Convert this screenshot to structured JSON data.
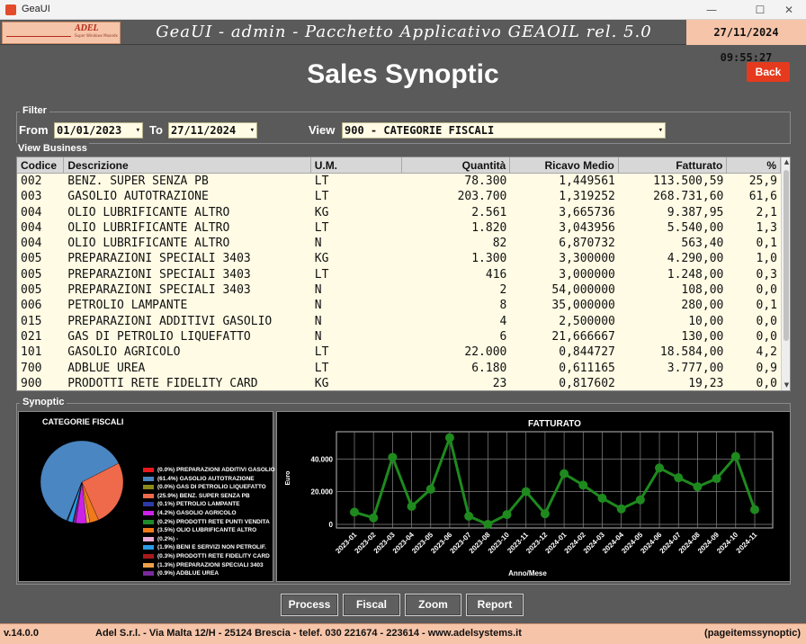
{
  "window": {
    "title": "GeaUI",
    "minimize": "—",
    "maximize": "☐",
    "close": "✕"
  },
  "header": {
    "logo_text": "ADEL",
    "logo_sub": "Super Windows Moondx",
    "app_title": "GeaUI - admin - Pacchetto Applicativo GEAOIL rel. 5.0",
    "datetime": "27/11/2024 09:55:27"
  },
  "page": {
    "title": "Sales Synoptic",
    "back_label": "Back"
  },
  "filter": {
    "legend": "Filter",
    "from_label": "From",
    "from_value": "01/01/2023",
    "to_label": "To",
    "to_value": "27/11/2024",
    "view_label": "View",
    "view_value": "900 - CATEGORIE FISCALI"
  },
  "business": {
    "legend": "View Business",
    "columns": [
      "Codice",
      "Descrizione",
      "U.M.",
      "Quantità",
      "Ricavo Medio",
      "Fatturato",
      "%"
    ],
    "rows": [
      [
        "002",
        "BENZ. SUPER SENZA PB",
        "LT",
        "78.300",
        "1,449561",
        "113.500,59",
        "25,9"
      ],
      [
        "003",
        "GASOLIO AUTOTRAZIONE",
        "LT",
        "203.700",
        "1,319252",
        "268.731,60",
        "61,6"
      ],
      [
        "004",
        "OLIO LUBRIFICANTE ALTRO",
        "KG",
        "2.561",
        "3,665736",
        "9.387,95",
        "2,1"
      ],
      [
        "004",
        "OLIO LUBRIFICANTE ALTRO",
        "LT",
        "1.820",
        "3,043956",
        "5.540,00",
        "1,3"
      ],
      [
        "004",
        "OLIO LUBRIFICANTE ALTRO",
        "N",
        "82",
        "6,870732",
        "563,40",
        "0,1"
      ],
      [
        "005",
        "PREPARAZIONI SPECIALI 3403",
        "KG",
        "1.300",
        "3,300000",
        "4.290,00",
        "1,0"
      ],
      [
        "005",
        "PREPARAZIONI SPECIALI 3403",
        "LT",
        "416",
        "3,000000",
        "1.248,00",
        "0,3"
      ],
      [
        "005",
        "PREPARAZIONI SPECIALI 3403",
        "N",
        "2",
        "54,000000",
        "108,00",
        "0,0"
      ],
      [
        "006",
        "PETROLIO LAMPANTE",
        "N",
        "8",
        "35,000000",
        "280,00",
        "0,1"
      ],
      [
        "015",
        "PREPARAZIONI ADDITIVI GASOLIO",
        "N",
        "4",
        "2,500000",
        "10,00",
        "0,0"
      ],
      [
        "021",
        "GAS DI PETROLIO LIQUEFATTO",
        "N",
        "6",
        "21,666667",
        "130,00",
        "0,0"
      ],
      [
        "101",
        "GASOLIO AGRICOLO",
        "LT",
        "22.000",
        "0,844727",
        "18.584,00",
        "4,2"
      ],
      [
        "700",
        "ADBLUE UREA",
        "LT",
        "6.180",
        "0,611165",
        "3.777,00",
        "0,9"
      ],
      [
        "900",
        "PRODOTTI RETE FIDELITY CARD",
        "KG",
        "23",
        "0,817602",
        "19,23",
        "0,0"
      ]
    ]
  },
  "synoptic": {
    "legend": "Synoptic"
  },
  "chart_data": [
    {
      "type": "pie",
      "title": "CATEGORIE FISCALI",
      "legend_position": "right",
      "slices": [
        {
          "label": "(0.0%) PREPARAZIONI ADDITIVI GASOLIO",
          "value": 0.0,
          "color": "#e8191c"
        },
        {
          "label": "(61.4%) GASOLIO AUTOTRAZIONE",
          "value": 61.4,
          "color": "#4a86c2"
        },
        {
          "label": "(0.0%) GAS DI PETROLIO LIQUEFATTO",
          "value": 0.0,
          "color": "#8a8a1a"
        },
        {
          "label": "(25.9%) BENZ. SUPER SENZA PB",
          "value": 25.9,
          "color": "#ee6a4a"
        },
        {
          "label": "(0.1%) PETROLIO LAMPANTE",
          "value": 0.1,
          "color": "#2a3aa8"
        },
        {
          "label": "(4.2%) GASOLIO AGRICOLO",
          "value": 4.2,
          "color": "#cc22e8"
        },
        {
          "label": "(0.2%) PRODOTTI RETE PUNTI VENDITA",
          "value": 0.2,
          "color": "#1e8a2a"
        },
        {
          "label": "(3.5%) OLIO LUBRIFICANTE ALTRO",
          "value": 3.5,
          "color": "#f07a1a"
        },
        {
          "label": "(0.2%) -",
          "value": 0.2,
          "color": "#e8a8d8"
        },
        {
          "label": "(1.9%) BENI E SERVIZI NON PETROLIF.",
          "value": 1.9,
          "color": "#2a9ae8"
        },
        {
          "label": "(0.3%) PRODOTTI RETE FIDELITY CARD",
          "value": 0.3,
          "color": "#a81a1a"
        },
        {
          "label": "(1.3%) PREPARAZIONI SPECIALI 3403",
          "value": 1.3,
          "color": "#f0a04a"
        },
        {
          "label": "(0.9%) ADBLUE UREA",
          "value": 0.9,
          "color": "#7a2a9a"
        }
      ]
    },
    {
      "type": "line",
      "title": "FATTURATO",
      "xlabel": "Anno/Mese",
      "ylabel": "Euro",
      "ylim": [
        0,
        55000
      ],
      "yticks": [
        "0",
        "20.000",
        "40.000"
      ],
      "ytick_values": [
        0,
        20000,
        40000
      ],
      "grid": true,
      "color": "#1e8a1e",
      "categories": [
        "2023-01",
        "2023-02",
        "2023-03",
        "2023-04",
        "2023-05",
        "2023-06",
        "2023-07",
        "2023-08",
        "2023-10",
        "2023-11",
        "2023-12",
        "2024-01",
        "2024-02",
        "2024-03",
        "2024-04",
        "2024-05",
        "2024-06",
        "2024-07",
        "2024-08",
        "2024-09",
        "2024-10",
        "2024-11"
      ],
      "values": [
        7500,
        4000,
        41000,
        11000,
        21500,
        53000,
        5000,
        0,
        6000,
        20000,
        6500,
        31000,
        24000,
        16000,
        9500,
        15000,
        34500,
        28500,
        23000,
        28000,
        41500,
        9000
      ]
    }
  ],
  "buttons": {
    "process": "Process",
    "fiscal": "Fiscal",
    "zoom": "Zoom",
    "report": "Report"
  },
  "footer": {
    "version": "v.14.0.0",
    "company": "Adel S.r.l. - Via Malta 12/H - 25124 Brescia - telef. 030 221674 - 223614 - www.adelsystems.it",
    "page_id": "(pageitemssynoptic)"
  }
}
